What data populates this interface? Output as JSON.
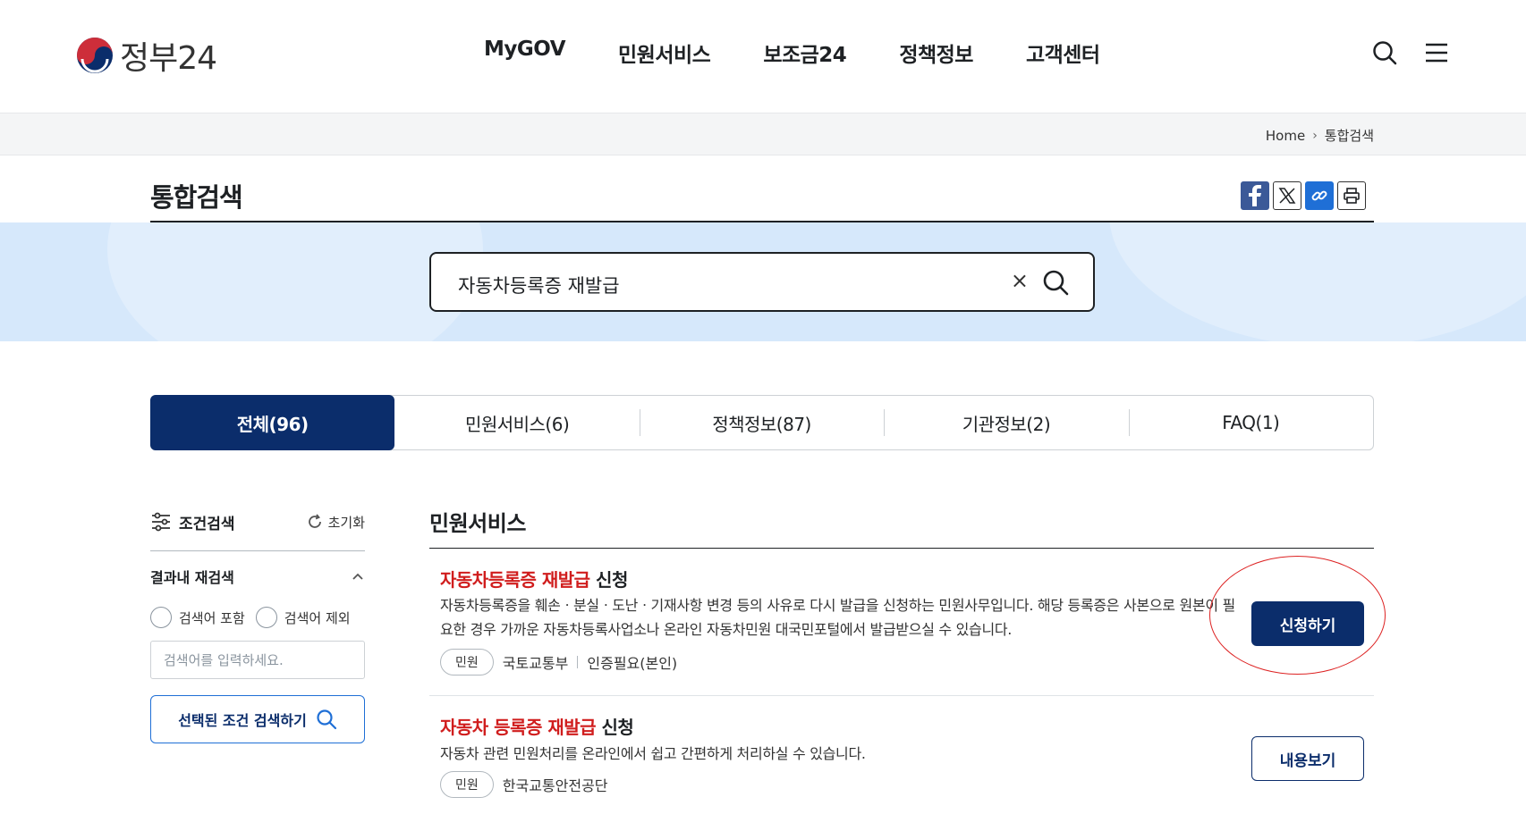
{
  "header": {
    "logo_text": "정부24",
    "nav": [
      "MyGOV",
      "민원서비스",
      "보조금24",
      "정책정보",
      "고객센터"
    ],
    "icons": {
      "search": "search-icon",
      "menu": "hamburger-menu-icon"
    }
  },
  "breadcrumb": {
    "home": "Home",
    "current": "통합검색"
  },
  "page": {
    "title": "통합검색",
    "share_icons": [
      "facebook-icon",
      "x-icon",
      "link-icon",
      "print-icon"
    ]
  },
  "search": {
    "value": "자동차등록증 재발급",
    "clear": "×"
  },
  "tabs": [
    {
      "label": "전체(96)",
      "active": true
    },
    {
      "label": "민원서비스(6)",
      "active": false
    },
    {
      "label": "정책정보(87)",
      "active": false
    },
    {
      "label": "기관정보(2)",
      "active": false
    },
    {
      "label": "FAQ(1)",
      "active": false
    }
  ],
  "sidebar": {
    "title": "조건검색",
    "reset": "초기화",
    "filter_title": "결과내 재검색",
    "radio_include": "검색어 포함",
    "radio_exclude": "검색어 제외",
    "input_placeholder": "검색어를 입력하세요.",
    "apply": "선택된 조건 검색하기"
  },
  "results": {
    "section_title": "민원서비스",
    "items": [
      {
        "title_hl": "자동차등록증 재발급",
        "title_rest": " 신청",
        "desc": "자동차등록증을 훼손ㆍ분실ㆍ도난ㆍ기재사항 변경 등의 사유로 다시 발급을 신청하는 민원사무입니다. 해당 등록증은 사본으로 원본이 필요한 경우 가까운 자동차등록사업소나 온라인 자동차민원 대국민포털에서 발급받으실 수 있습니다.",
        "chip": "민원",
        "org": "국토교통부",
        "auth": "인증필요(본인)",
        "button": "신청하기"
      },
      {
        "title_hl": "자동차 등록증 재발급",
        "title_rest": " 신청",
        "desc": "자동차 관련 민원처리를 온라인에서 쉽고 간편하게 처리하실 수 있습니다.",
        "chip": "민원",
        "org": "한국교통안전공단",
        "button": "내용보기"
      }
    ]
  },
  "colors": {
    "primary": "#0b2d6b",
    "highlight": "#d01d1d",
    "band": "#d6e8fb",
    "annotation": "#dd2222"
  }
}
